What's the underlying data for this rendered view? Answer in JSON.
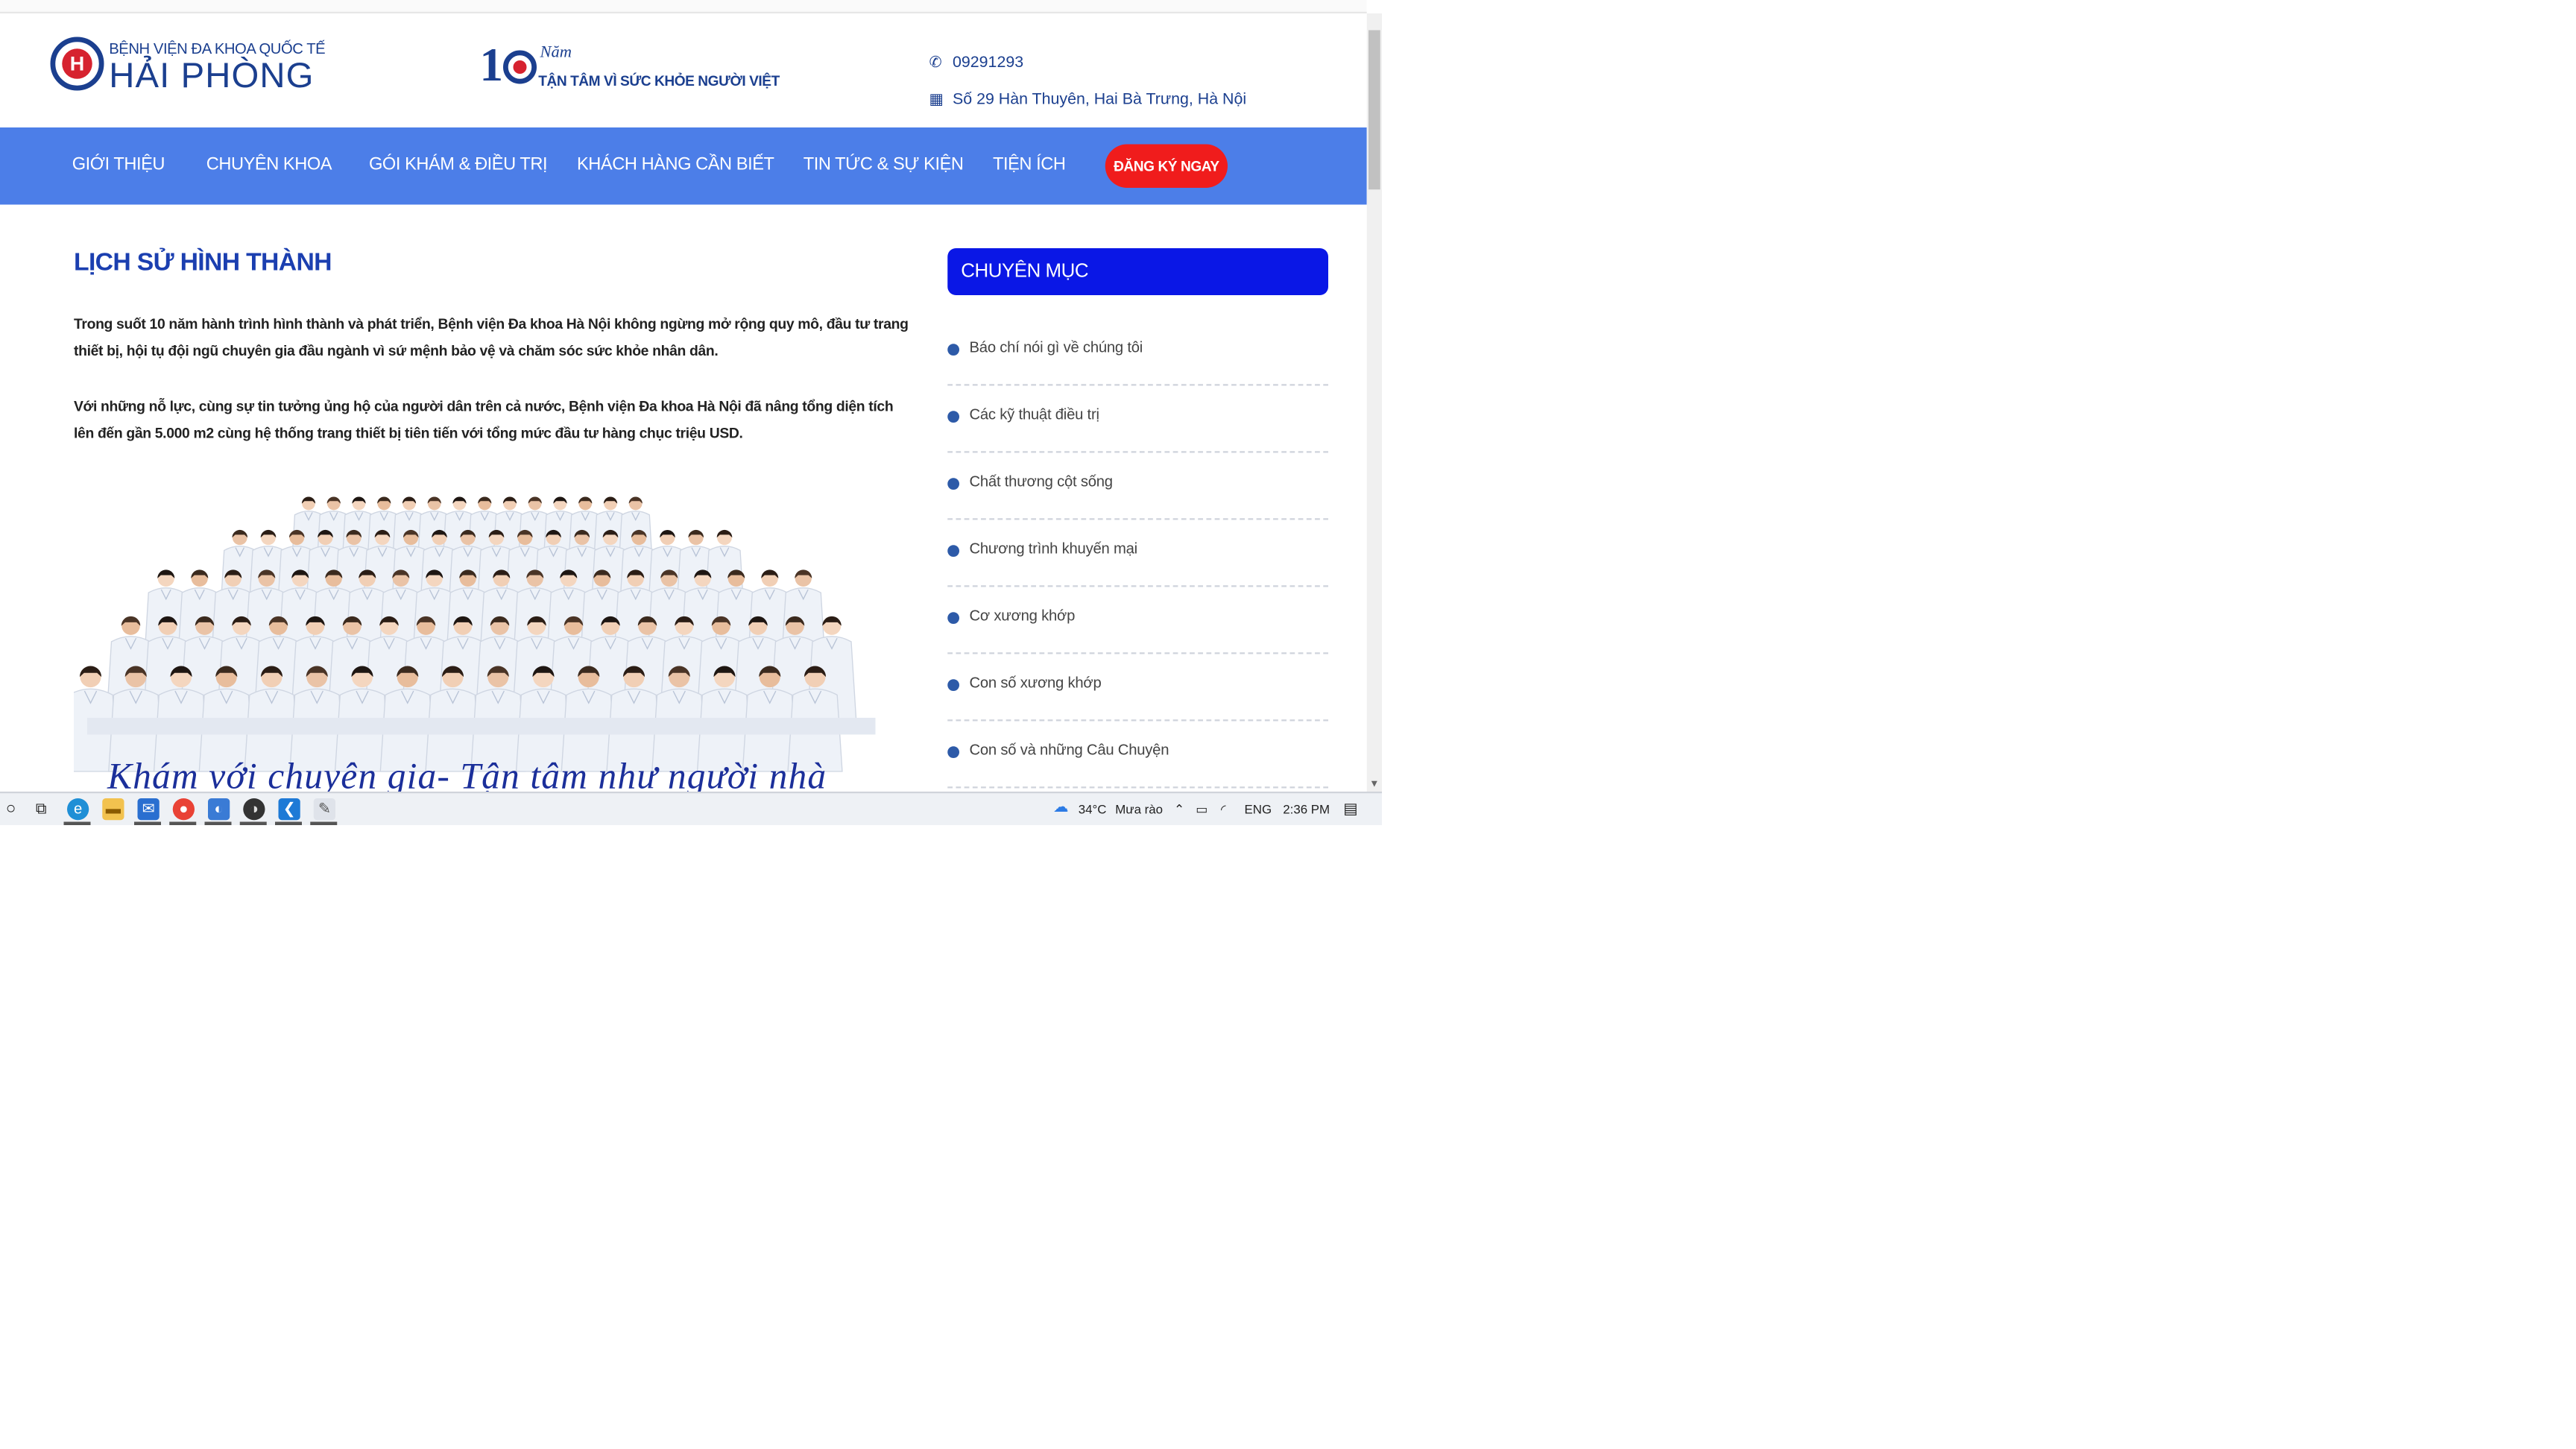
{
  "header": {
    "logo_line1": "BỆNH VIỆN ĐA KHOA QUỐC TẾ",
    "logo_line2": "HẢI PHÒNG",
    "badge_number": "10",
    "badge_nam": "Năm",
    "badge_slogan": "TẬN TÂM VÌ SỨC KHỎE NGƯỜI VIỆT",
    "phone": "09291293",
    "address": "Số 29 Hàn Thuyên, Hai Bà Trưng, Hà Nội"
  },
  "nav": {
    "items": [
      "GIỚI THIỆU",
      "CHUYÊN KHOA",
      "GÓI KHÁM & ĐIỀU TRỊ",
      "KHÁCH HÀNG CẦN BIẾT",
      "TIN TỨC & SỰ KIỆN",
      "TIỆN ÍCH"
    ],
    "cta": "ĐĂNG KÝ NGAY"
  },
  "main": {
    "title": "LỊCH SỬ HÌNH THÀNH",
    "paragraph1": "Trong suốt 10 năm hành trình hình thành và phát triển, Bệnh viện Đa khoa Hà Nội không ngừng mở rộng quy mô, đầu tư trang thiết bị, hội tụ đội ngũ chuyên gia đầu ngành vì sứ mệnh bảo vệ và chăm sóc sức khỏe nhân dân.",
    "paragraph2": "Với những nỗ lực, cùng sự tin tưởng ủng hộ của người dân trên cả nước, Bệnh viện Đa khoa Hà Nội đã nâng tổng diện tích lên đến gần 5.000 m2 cùng hệ thống trang thiết bị tiên tiến với tổng mức đầu tư hàng chục triệu USD.",
    "photo_caption": "Khám với chuyên gia- Tận tâm như người nhà"
  },
  "sidebar": {
    "heading": "CHUYÊN MỤC",
    "items": [
      "Báo chí nói gì về chúng tôi",
      "Các kỹ thuật điều trị",
      "Chất thương cột sống",
      "Chương trình khuyến mại",
      "Cơ xương khớp",
      "Con số xương khớp",
      "Con số và những Câu Chuyện"
    ]
  },
  "taskbar": {
    "weather_temp": "34°C",
    "weather_text": "Mưa rào",
    "language": "ENG",
    "time": "2:36 PM"
  },
  "colors": {
    "nav_bg": "#4c7ee8",
    "cta_bg": "#f01c1c",
    "sidebar_head_bg": "#0a17e6",
    "title": "#1b3fb0",
    "brand": "#1b3f8f"
  }
}
